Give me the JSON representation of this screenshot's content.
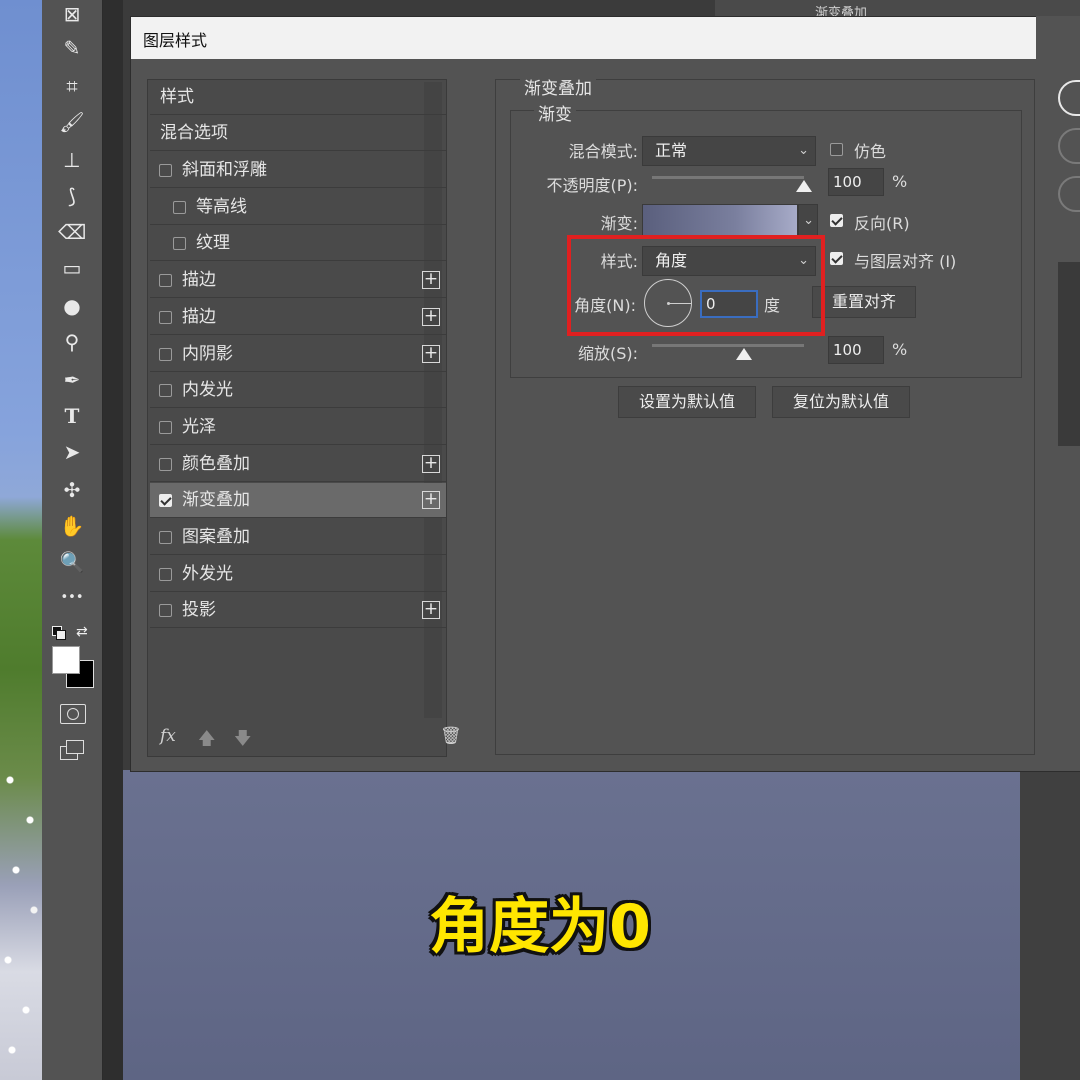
{
  "dialog": {
    "title": "图层样式"
  },
  "top_panel_text": "渐变叠加",
  "style_list": {
    "header": "样式",
    "blend_options": "混合选项",
    "items": [
      {
        "label": "斜面和浮雕",
        "checked": false,
        "indent": false,
        "plus": false
      },
      {
        "label": "等高线",
        "checked": false,
        "indent": true,
        "plus": false
      },
      {
        "label": "纹理",
        "checked": false,
        "indent": true,
        "plus": false
      },
      {
        "label": "描边",
        "checked": false,
        "indent": false,
        "plus": true
      },
      {
        "label": "描边",
        "checked": false,
        "indent": false,
        "plus": true
      },
      {
        "label": "内阴影",
        "checked": false,
        "indent": false,
        "plus": true
      },
      {
        "label": "内发光",
        "checked": false,
        "indent": false,
        "plus": false
      },
      {
        "label": "光泽",
        "checked": false,
        "indent": false,
        "plus": false
      },
      {
        "label": "颜色叠加",
        "checked": false,
        "indent": false,
        "plus": true
      },
      {
        "label": "渐变叠加",
        "checked": true,
        "indent": false,
        "plus": true
      },
      {
        "label": "图案叠加",
        "checked": false,
        "indent": false,
        "plus": false
      },
      {
        "label": "外发光",
        "checked": false,
        "indent": false,
        "plus": false
      },
      {
        "label": "投影",
        "checked": false,
        "indent": false,
        "plus": true
      }
    ],
    "footer": {
      "fx": "fx",
      "up_arrow": "🡅",
      "down_arrow": "🡇",
      "trash": "🗑"
    }
  },
  "settings": {
    "section_title": "渐变叠加",
    "group_title": "渐变",
    "blend_mode_label": "混合模式:",
    "blend_mode_value": "正常",
    "dither_label": "仿色",
    "opacity_label": "不透明度(P):",
    "opacity_value": "100",
    "percent": "%",
    "gradient_label": "渐变:",
    "reverse_label": "反向(R)",
    "reverse_checked": true,
    "style_label": "样式:",
    "style_value": "角度",
    "align_label": "与图层对齐 (I)",
    "align_checked": true,
    "angle_label": "角度(N):",
    "angle_value": "0",
    "degree_unit": "度",
    "reset_align_button": "重置对齐",
    "scale_label": "缩放(S):",
    "scale_value": "100",
    "set_default_button": "设置为默认值",
    "reset_default_button": "复位为默认值"
  },
  "caption": "角度为0",
  "tools": [
    {
      "name": "frame-tool-icon",
      "glyph": "⊠"
    },
    {
      "name": "eyedropper-tool-icon",
      "glyph": "✎"
    },
    {
      "name": "crop-tool-icon",
      "glyph": "⌗"
    },
    {
      "name": "brush-tool-icon",
      "glyph": "🖌"
    },
    {
      "name": "stamp-tool-icon",
      "glyph": "⊥"
    },
    {
      "name": "history-brush-tool-icon",
      "glyph": "⟆"
    },
    {
      "name": "eraser-tool-icon",
      "glyph": "⌫"
    },
    {
      "name": "gradient-tool-icon",
      "glyph": "▭"
    },
    {
      "name": "blur-tool-icon",
      "glyph": "●"
    },
    {
      "name": "dodge-tool-icon",
      "glyph": "⚲"
    },
    {
      "name": "pen-tool-icon",
      "glyph": "✒"
    },
    {
      "name": "type-tool-icon",
      "glyph": "T"
    },
    {
      "name": "path-selection-tool-icon",
      "glyph": "➤"
    },
    {
      "name": "custom-shape-tool-icon",
      "glyph": "✣"
    },
    {
      "name": "hand-tool-icon",
      "glyph": "✋"
    },
    {
      "name": "zoom-tool-icon",
      "glyph": "🔍"
    },
    {
      "name": "more-tools-icon",
      "glyph": "•••"
    }
  ]
}
